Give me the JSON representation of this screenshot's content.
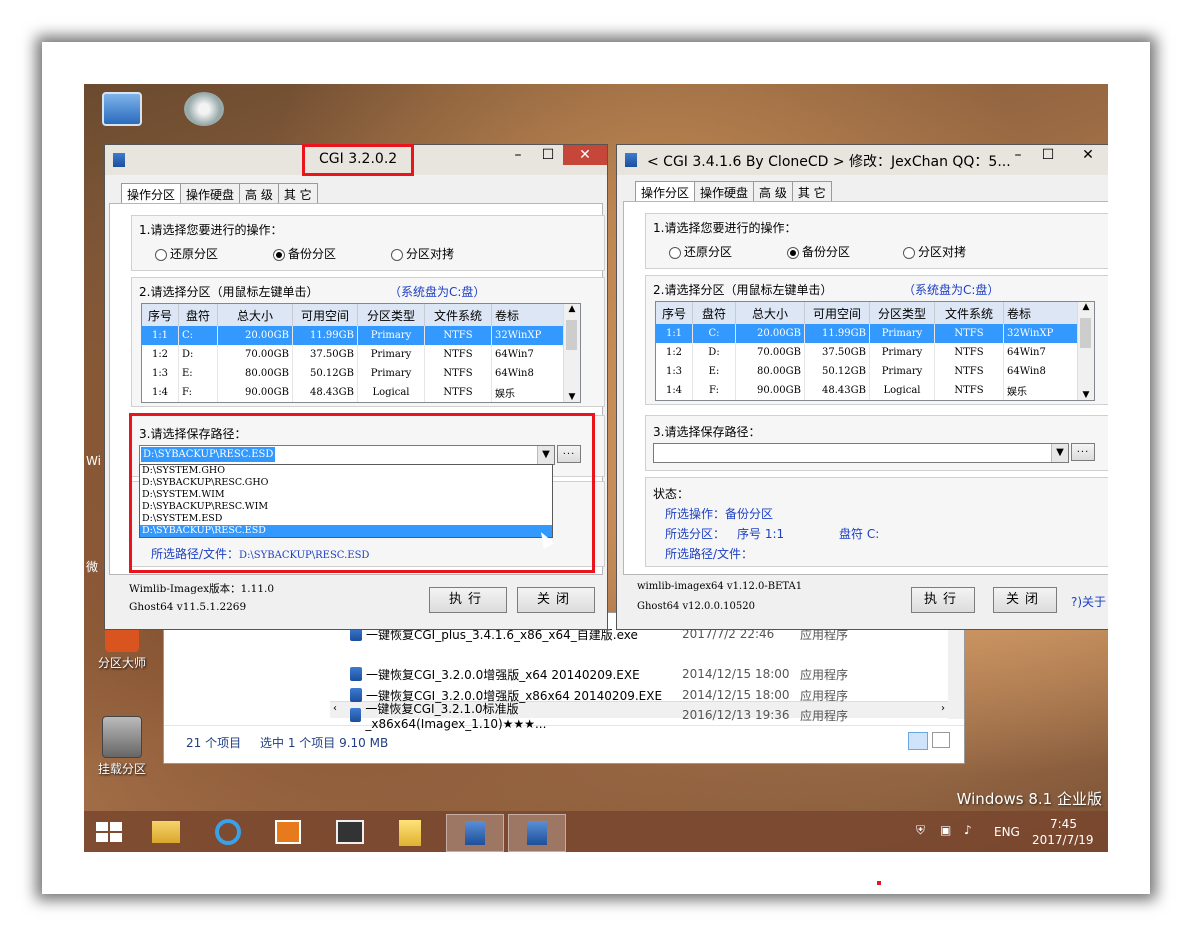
{
  "desktop": {
    "icons": [
      {
        "label": "分区大师"
      },
      {
        "label": "挂载分区"
      }
    ],
    "partial_labels": {
      "left1": "Wi",
      "left2": "微"
    },
    "watermark": "Windows 8.1 企业版"
  },
  "explorer": {
    "rows": [
      {
        "name": "一键恢复CGI_plus_3.4.1.6_x86_x64_自建版.exe",
        "date": "2017/7/2 22:46",
        "type": "应用程序"
      },
      {
        "name": "一键恢复CGI_3.2.0.0增强版_x64 20140209.EXE",
        "date": "2014/12/15 18:00",
        "type": "应用程序"
      },
      {
        "name": "一键恢复CGI_3.2.0.0增强版_x86x64 20140209.EXE",
        "date": "2014/12/15 18:00",
        "type": "应用程序"
      },
      {
        "name": "一键恢复CGI_3.2.1.0标准版_x86x64(Imagex_1.10)★★★...",
        "date": "2016/12/13 19:36",
        "type": "应用程序"
      }
    ],
    "status_count": "21 个项目",
    "status_selected": "选中 1 个项目 9.10 MB"
  },
  "left_dialog": {
    "title": "CGI 3.2.0.2",
    "tabs": [
      "操作分区",
      "操作硬盘",
      "高 级",
      "其 它"
    ],
    "step1_label": "1.请选择您要进行的操作：",
    "radio_restore": "还原分区",
    "radio_backup": "备份分区",
    "radio_compare": "分区对拷",
    "step2_label": "2.请选择分区（用鼠标左键单击）",
    "system_note": "（系统盘为C:盘）",
    "columns": [
      "序号",
      "盘符",
      "总大小",
      "可用空间",
      "分区类型",
      "文件系统",
      "卷标"
    ],
    "rows": [
      [
        "1:1",
        "C:",
        "20.00GB",
        "11.99GB",
        "Primary",
        "NTFS",
        "32WinXP"
      ],
      [
        "1:2",
        "D:",
        "70.00GB",
        "37.50GB",
        "Primary",
        "NTFS",
        "64Win7"
      ],
      [
        "1:3",
        "E:",
        "80.00GB",
        "50.12GB",
        "Primary",
        "NTFS",
        "64Win8"
      ],
      [
        "1:4",
        "F:",
        "90.00GB",
        "48.43GB",
        "Logical",
        "NTFS",
        "娱乐"
      ]
    ],
    "step3_label": "3.请选择保存路径：",
    "path_value": "D:\\SYBACKUP\\RESC.ESD",
    "browse_label": "...",
    "dropdown_options": [
      "D:\\SYSTEM.GHO",
      "D:\\SYBACKUP\\RESC.GHO",
      "D:\\SYSTEM.WIM",
      "D:\\SYBACKUP\\RESC.WIM",
      "D:\\SYSTEM.ESD",
      "D:\\SYBACKUP\\RESC.ESD"
    ],
    "selected_path_label": "所选路径/文件：",
    "selected_path_value": "D:\\SYBACKUP\\RESC.ESD",
    "version1": "Wimlib-Imagex版本：1.11.0",
    "version2": "Ghost64 v11.5.1.2269",
    "execute_label": "执行",
    "close_label": "关闭"
  },
  "right_dialog": {
    "title": "< CGI 3.4.1.6 By CloneCD > 修改：JexChan QQ：5...",
    "tabs": [
      "操作分区",
      "操作硬盘",
      "高 级",
      "其 它"
    ],
    "step1_label": "1.请选择您要进行的操作：",
    "radio_restore": "还原分区",
    "radio_backup": "备份分区",
    "radio_compare": "分区对拷",
    "step2_label": "2.请选择分区（用鼠标左键单击）",
    "system_note": "（系统盘为C:盘）",
    "columns": [
      "序号",
      "盘符",
      "总大小",
      "可用空间",
      "分区类型",
      "文件系统",
      "卷标"
    ],
    "rows": [
      [
        "1:1",
        "C:",
        "20.00GB",
        "11.99GB",
        "Primary",
        "NTFS",
        "32WinXP"
      ],
      [
        "1:2",
        "D:",
        "70.00GB",
        "37.50GB",
        "Primary",
        "NTFS",
        "64Win7"
      ],
      [
        "1:3",
        "E:",
        "80.00GB",
        "50.12GB",
        "Primary",
        "NTFS",
        "64Win8"
      ],
      [
        "1:4",
        "F:",
        "90.00GB",
        "48.43GB",
        "Logical",
        "NTFS",
        "娱乐"
      ]
    ],
    "step3_label": "3.请选择保存路径：",
    "browse_label": "...",
    "status_label": "状态：",
    "op_label": "所选操作：备份分区",
    "part_label": "所选分区：",
    "part_index": "序号 1:1",
    "part_drive": "盘符 C:",
    "path_label": "所选路径/文件：",
    "version1": "wimlib-imagex64 v1.12.0-BETA1",
    "version2": "Ghost64 v12.0.0.10520",
    "execute_label": "执行",
    "close_label": "关闭",
    "about_label": "?)关于"
  },
  "tray": {
    "lang": "ENG",
    "time": "7:45",
    "date": "2017/7/19"
  },
  "colors": {
    "accent": "#3399ff",
    "highlight_box": "#e8151c",
    "link": "#1c3fc4"
  }
}
